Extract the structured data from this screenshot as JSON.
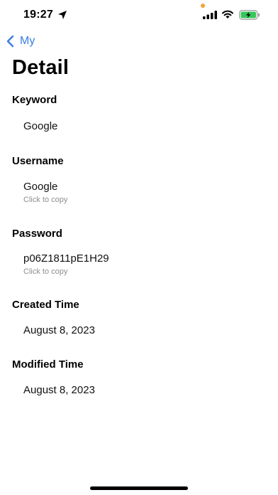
{
  "status_bar": {
    "time": "19:27",
    "icons": [
      "location-arrow-icon",
      "signal-icon",
      "wifi-icon",
      "battery-charging-icon"
    ],
    "privacy_dot_color": "#f2a33a"
  },
  "nav": {
    "back_label": "My",
    "back_icon": "chevron-left-icon",
    "accent_color": "#3a7ee0"
  },
  "page": {
    "title": "Detail"
  },
  "fields": {
    "keyword": {
      "label": "Keyword",
      "value": "Google"
    },
    "username": {
      "label": "Username",
      "value": "Google",
      "hint": "Click to copy"
    },
    "password": {
      "label": "Password",
      "value": "p06Z1811pE1H29",
      "hint": "Click to copy"
    },
    "created": {
      "label": "Created Time",
      "value": "August 8, 2023"
    },
    "modified": {
      "label": "Modified Time",
      "value": "August 8, 2023"
    }
  }
}
